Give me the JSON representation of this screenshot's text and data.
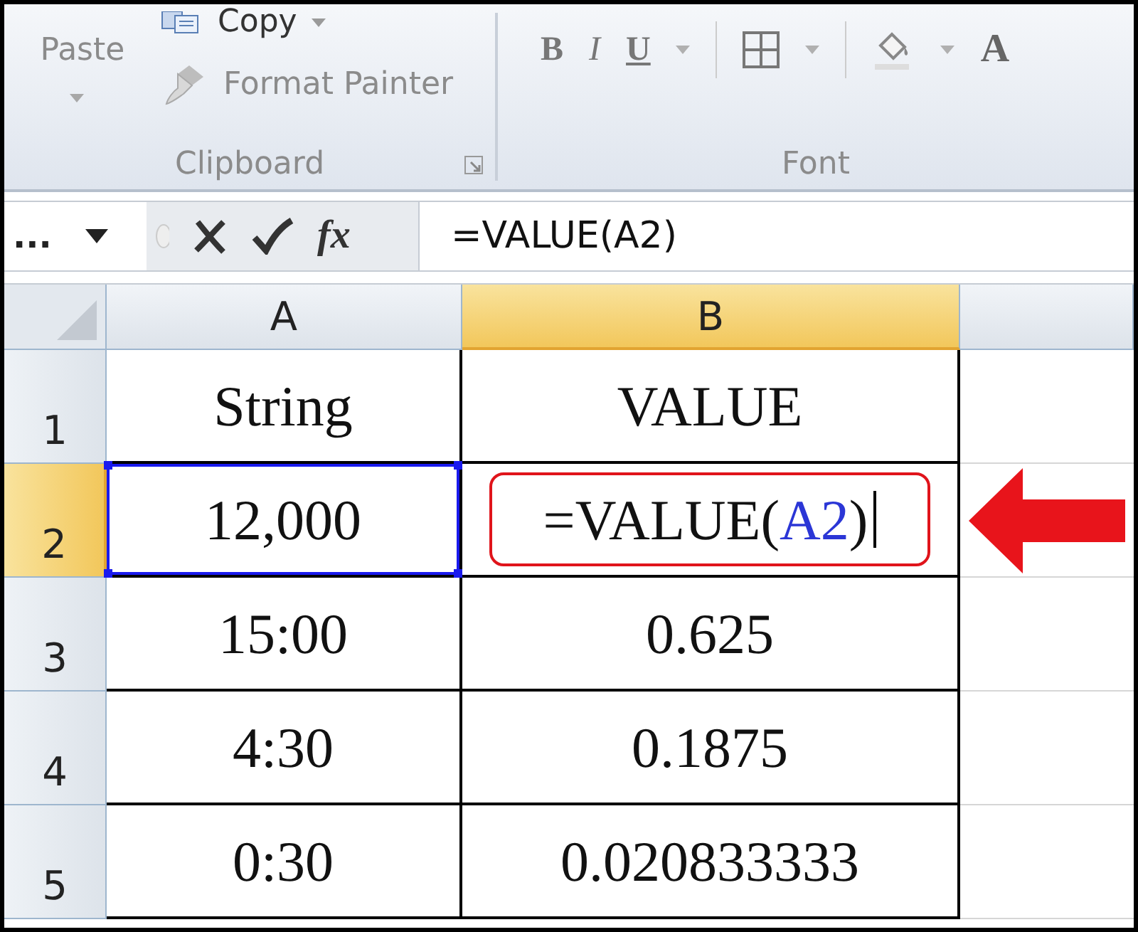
{
  "ribbon": {
    "clipboard": {
      "paste": "Paste",
      "copy": "Copy",
      "format_painter": "Format Painter",
      "label": "Clipboard"
    },
    "font": {
      "label": "Font",
      "bold": "B",
      "italic": "I",
      "underline": "U",
      "font_color": "A"
    }
  },
  "formula_bar": {
    "name_box": "...",
    "function_button": "fx",
    "formula": "=VALUE(A2)"
  },
  "sheet": {
    "columns": [
      {
        "label": "A",
        "selected": false
      },
      {
        "label": "B",
        "selected": true
      }
    ],
    "rows": [
      {
        "number": "1",
        "selected": false,
        "cells": [
          {
            "kind": "plain",
            "parts": [
              {
                "kind": "text",
                "text": "String"
              }
            ]
          },
          {
            "kind": "plain",
            "parts": [
              {
                "kind": "text",
                "text": "VALUE"
              }
            ]
          }
        ]
      },
      {
        "number": "2",
        "selected": true,
        "cells": [
          {
            "kind": "range",
            "parts": [
              {
                "kind": "text",
                "text": "12,000"
              }
            ]
          },
          {
            "kind": "editing",
            "parts": [
              {
                "kind": "text",
                "text": "=VALUE("
              },
              {
                "kind": "ref",
                "text": "A2"
              },
              {
                "kind": "text",
                "text": ")"
              }
            ]
          }
        ]
      },
      {
        "number": "3",
        "selected": false,
        "cells": [
          {
            "kind": "plain",
            "parts": [
              {
                "kind": "text",
                "text": "15:00"
              }
            ]
          },
          {
            "kind": "plain",
            "parts": [
              {
                "kind": "text",
                "text": "0.625"
              }
            ]
          }
        ]
      },
      {
        "number": "4",
        "selected": false,
        "cells": [
          {
            "kind": "plain",
            "parts": [
              {
                "kind": "text",
                "text": "4:30"
              }
            ]
          },
          {
            "kind": "plain",
            "parts": [
              {
                "kind": "text",
                "text": "0.1875"
              }
            ]
          }
        ]
      },
      {
        "number": "5",
        "selected": false,
        "cells": [
          {
            "kind": "plain",
            "parts": [
              {
                "kind": "text",
                "text": "0:30"
              }
            ]
          },
          {
            "kind": "plain",
            "parts": [
              {
                "kind": "text",
                "text": "0.020833333"
              }
            ]
          }
        ]
      }
    ]
  }
}
